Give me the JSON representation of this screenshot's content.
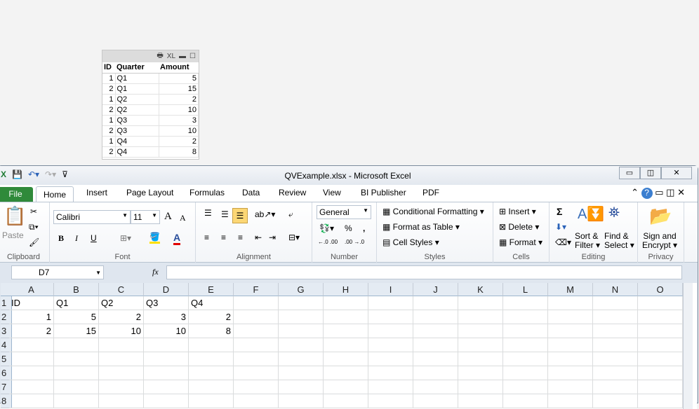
{
  "qv_table": {
    "caption_icons": [
      "print-icon",
      "XL",
      "minimize",
      "maximize"
    ],
    "headers": [
      "ID",
      "Quarter",
      "Amount"
    ],
    "rows": [
      [
        "1",
        "Q1",
        "5"
      ],
      [
        "2",
        "Q1",
        "15"
      ],
      [
        "1",
        "Q2",
        "2"
      ],
      [
        "2",
        "Q2",
        "10"
      ],
      [
        "1",
        "Q3",
        "3"
      ],
      [
        "2",
        "Q3",
        "10"
      ],
      [
        "1",
        "Q4",
        "2"
      ],
      [
        "2",
        "Q4",
        "8"
      ]
    ]
  },
  "window": {
    "title": "QVExample.xlsx  -  Microsoft Excel"
  },
  "tabs": [
    "File",
    "Home",
    "Insert",
    "Page Layout",
    "Formulas",
    "Data",
    "Review",
    "View",
    "BI Publisher",
    "PDF"
  ],
  "ribbon": {
    "clipboard": {
      "label": "Clipboard",
      "paste": "Paste"
    },
    "font": {
      "label": "Font",
      "name": "Calibri",
      "size": "11",
      "bold": "B",
      "italic": "I",
      "underline": "U",
      "grow": "A",
      "shrink": "A",
      "color": "A"
    },
    "alignment": {
      "label": "Alignment"
    },
    "number": {
      "label": "Number",
      "format": "General",
      "percent": "%",
      "comma": ",",
      "inc": "←.0 .00",
      "dec": ".00 →.0"
    },
    "styles": {
      "label": "Styles",
      "conditional": "Conditional Formatting",
      "table": "Format as Table",
      "cell": "Cell Styles"
    },
    "cells": {
      "label": "Cells",
      "insert": "Insert",
      "delete": "Delete",
      "format": "Format"
    },
    "editing": {
      "label": "Editing",
      "sum": "Σ",
      "sort1": "Sort &",
      "sort2": "Filter",
      "find1": "Find &",
      "find2": "Select"
    },
    "privacy": {
      "label": "Privacy",
      "sign1": "Sign and",
      "sign2": "Encrypt"
    }
  },
  "formula_bar": {
    "name_box": "D7",
    "fx": "fx",
    "value": ""
  },
  "sheet": {
    "columns": [
      "A",
      "B",
      "C",
      "D",
      "E",
      "F",
      "G",
      "H",
      "I",
      "J",
      "K",
      "L",
      "M",
      "N",
      "O"
    ],
    "rows": [
      "1",
      "2",
      "3",
      "4",
      "5",
      "6",
      "7",
      "8"
    ],
    "cells": [
      [
        "ID",
        "Q1",
        "Q2",
        "Q3",
        "Q4"
      ],
      [
        "1",
        "5",
        "2",
        "3",
        "2"
      ],
      [
        "2",
        "15",
        "10",
        "10",
        "8"
      ]
    ]
  }
}
